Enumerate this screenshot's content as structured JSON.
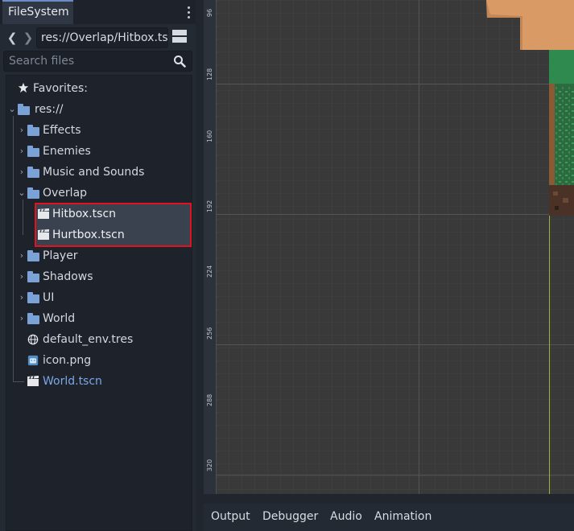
{
  "dock": {
    "tab_label": "FileSystem",
    "path_value": "res://Overlap/Hitbox.ts",
    "search_placeholder": "Search files",
    "tree": {
      "favorites": "Favorites:",
      "root": "res://",
      "folders": [
        "Effects",
        "Enemies",
        "Music and Sounds",
        "Overlap"
      ],
      "overlap_children": [
        "Hitbox.tscn",
        "Hurtbox.tscn"
      ],
      "more_folders": [
        "Player",
        "Shadows",
        "UI",
        "World"
      ],
      "files": [
        "default_env.tres",
        "icon.png",
        "World.tscn"
      ]
    }
  },
  "viewport": {
    "ruler_labels": [
      "96",
      "128",
      "160",
      "192",
      "224",
      "256",
      "288",
      "320"
    ]
  },
  "bottom_panel": {
    "tabs": [
      "Output",
      "Debugger",
      "Audio",
      "Animation"
    ]
  },
  "colors": {
    "selection_outline": "#e0141e",
    "folder": "#7aa2d6",
    "current_scene": "#7ba6e6"
  }
}
